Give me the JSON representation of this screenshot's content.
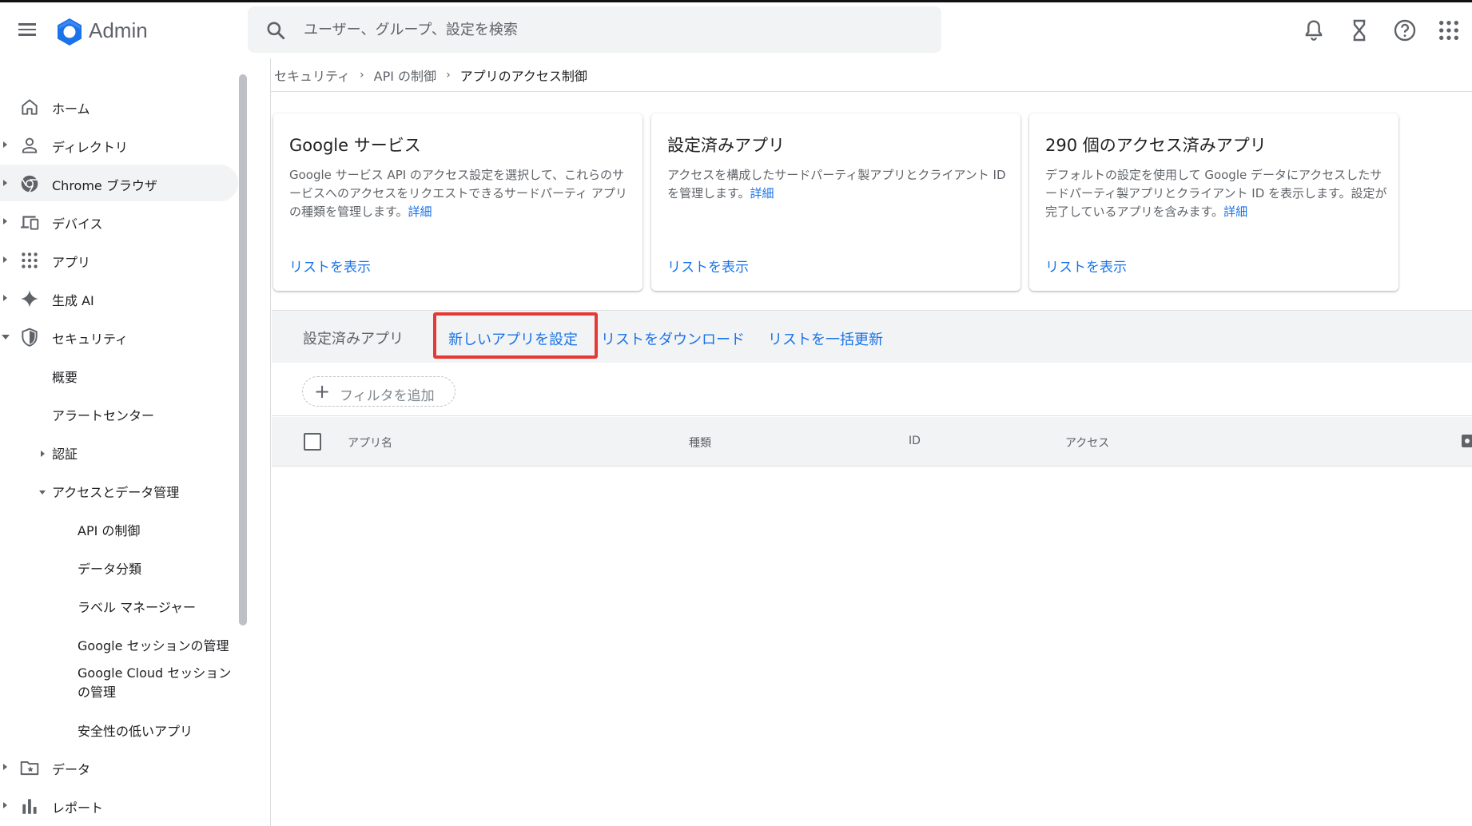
{
  "header": {
    "app_title": "Admin",
    "search_placeholder": "ユーザー、グループ、設定を検索"
  },
  "sidebar": {
    "items": [
      {
        "label": "ホーム",
        "icon": "home-icon"
      },
      {
        "label": "ディレクトリ",
        "icon": "person-icon"
      },
      {
        "label": "Chrome ブラウザ",
        "icon": "chrome-icon"
      },
      {
        "label": "デバイス",
        "icon": "devices-icon"
      },
      {
        "label": "アプリ",
        "icon": "apps-grid-icon"
      },
      {
        "label": "生成 AI",
        "icon": "sparkle-icon"
      },
      {
        "label": "セキュリティ",
        "icon": "shield-icon"
      }
    ],
    "security_sub": [
      "概要",
      "アラートセンター",
      "認証",
      "アクセスとデータ管理"
    ],
    "access_sub": [
      "API の制御",
      "データ分類",
      "ラベル マネージャー",
      "Google セッションの管理",
      "Google Cloud セッション",
      "の管理",
      "安全性の低いアプリ"
    ],
    "bottom_items": [
      {
        "label": "データ",
        "icon": "folder-star-icon"
      },
      {
        "label": "レポート",
        "icon": "bar-chart-icon"
      }
    ]
  },
  "breadcrumb": [
    "セキュリティ",
    "API の制御",
    "アプリのアクセス制御"
  ],
  "cards": [
    {
      "title": "Google サービス",
      "desc": "Google サービス API のアクセス設定を選択して、これらのサービスへのアクセスをリクエストできるサードパーティ アプリの種類を管理します。",
      "detail": "詳細",
      "link": "リストを表示"
    },
    {
      "title": "設定済みアプリ",
      "desc": "アクセスを構成したサードパーティ製アプリとクライアント ID を管理します。",
      "detail": "詳細",
      "link": "リストを表示"
    },
    {
      "title": "290 個のアクセス済みアプリ",
      "desc": "デフォルトの設定を使用して Google データにアクセスしたサードパーティ製アプリとクライアント ID を表示します。設定が完了しているアプリを含みます。",
      "detail": "詳細",
      "link": "リストを表示"
    }
  ],
  "toolbar": {
    "title": "設定済みアプリ",
    "configure_new": "新しいアプリを設定",
    "download": "リストをダウンロード",
    "bulk_update": "リストを一括更新"
  },
  "filter": {
    "add_label": "フィルタを追加"
  },
  "table": {
    "columns": [
      "アプリ名",
      "種類",
      "ID",
      "アクセス"
    ]
  },
  "colors": {
    "link": "#1a73e8",
    "highlight": "#e53935",
    "toolbar_bg": "#f1f3f4"
  }
}
